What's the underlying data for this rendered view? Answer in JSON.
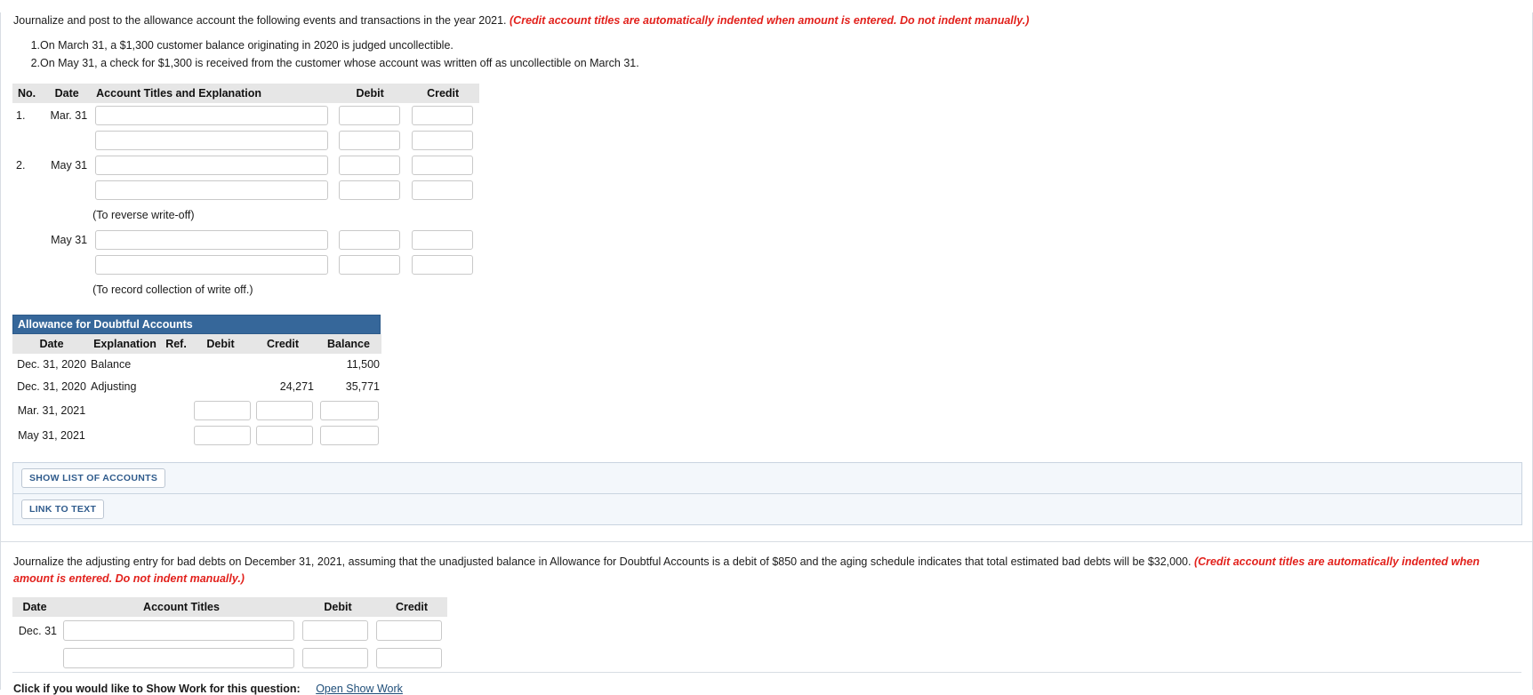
{
  "question1": {
    "intro_text": "Journalize and post to the allowance account the following events and transactions in the year 2021.",
    "intro_note": "(Credit account titles are automatically indented when amount is entered. Do not indent manually.)",
    "events": [
      {
        "num": "1.",
        "text": "On March 31, a $1,300 customer balance originating in 2020 is judged uncollectible."
      },
      {
        "num": "2.",
        "text": "On May 31, a check for $1,300 is received from the customer whose account was written off as uncollectible on March 31."
      }
    ],
    "journal": {
      "headers": {
        "no": "No.",
        "date": "Date",
        "account": "Account Titles and Explanation",
        "debit": "Debit",
        "credit": "Credit"
      },
      "rows": [
        {
          "no": "1.",
          "date": "Mar. 31",
          "account": "",
          "debit": "",
          "credit": "",
          "memo": ""
        },
        {
          "no": "",
          "date": "",
          "account": "",
          "debit": "",
          "credit": "",
          "memo": ""
        },
        {
          "no": "2.",
          "date": "May 31",
          "account": "",
          "debit": "",
          "credit": "",
          "memo": ""
        },
        {
          "no": "",
          "date": "",
          "account": "",
          "debit": "",
          "credit": "",
          "memo": "(To reverse write-off)"
        },
        {
          "no": "",
          "date": "May 31",
          "account": "",
          "debit": "",
          "credit": "",
          "memo": ""
        },
        {
          "no": "",
          "date": "",
          "account": "",
          "debit": "",
          "credit": "",
          "memo": "(To record collection of write off.)"
        }
      ]
    },
    "ledger": {
      "title": "Allowance for Doubtful Accounts",
      "headers": [
        "Date",
        "Explanation",
        "Ref.",
        "Debit",
        "Credit",
        "Balance"
      ],
      "rows": [
        {
          "date": "Dec. 31, 2020",
          "explanation": "Balance",
          "ref": "",
          "debit": "",
          "credit": "",
          "balance": "11,500",
          "editable": false
        },
        {
          "date": "Dec. 31, 2020",
          "explanation": "Adjusting",
          "ref": "",
          "debit": "",
          "credit": "24,271",
          "balance": "35,771",
          "editable": false
        },
        {
          "date": "Mar. 31, 2021",
          "explanation": "",
          "ref": "",
          "debit": "",
          "credit": "",
          "balance": "",
          "editable": true
        },
        {
          "date": "May 31, 2021",
          "explanation": "",
          "ref": "",
          "debit": "",
          "credit": "",
          "balance": "",
          "editable": true
        }
      ]
    },
    "buttons": {
      "show_list_of_accounts": "SHOW LIST OF ACCOUNTS",
      "link_to_text": "LINK TO TEXT"
    }
  },
  "question2": {
    "prose_text": "Journalize the adjusting entry for bad debts on December 31, 2021, assuming that the unadjusted balance in Allowance for Doubtful Accounts is a debit of $850 and the aging schedule indicates that total estimated bad debts will be $32,000.",
    "prose_note": "(Credit account titles are automatically indented when amount is entered. Do not indent manually.)",
    "journal": {
      "headers": {
        "date": "Date",
        "account": "Account Titles",
        "debit": "Debit",
        "credit": "Credit"
      },
      "rows": [
        {
          "date": "Dec. 31",
          "account": "",
          "debit": "",
          "credit": ""
        },
        {
          "date": "",
          "account": "",
          "debit": "",
          "credit": ""
        }
      ]
    },
    "show_work_label": "Click if you would like to Show Work for this question:",
    "show_work_link": "Open Show Work"
  },
  "colors": {
    "header_blue": "#36679a",
    "note_red": "#e2211c",
    "table_header_gray": "#e6e6e6",
    "actionbar_bg": "#f3f7fb",
    "link_blue": "#1f4e79"
  }
}
